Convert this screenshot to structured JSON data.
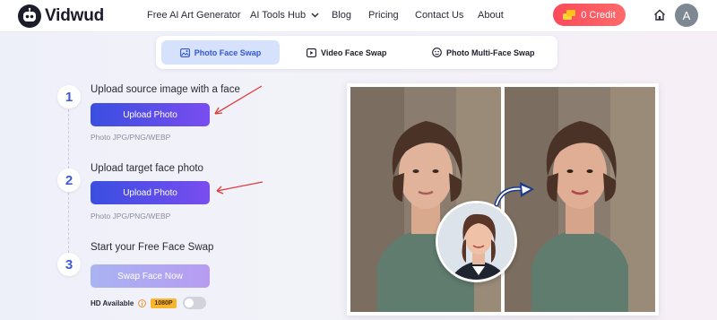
{
  "header": {
    "brand": "Vidwud",
    "nav": [
      {
        "label": "Free AI Art Generator"
      },
      {
        "label": "AI Tools Hub"
      },
      {
        "label": "Blog"
      },
      {
        "label": "Pricing"
      },
      {
        "label": "Contact Us"
      },
      {
        "label": "About"
      }
    ],
    "credit_label": "0 Credit",
    "avatar_letter": "A"
  },
  "tabs": [
    {
      "label": "Photo Face Swap",
      "active": true
    },
    {
      "label": "Video Face Swap",
      "active": false
    },
    {
      "label": "Photo Multi-Face Swap",
      "active": false
    }
  ],
  "steps": [
    {
      "number": "1",
      "title": "Upload source image with a face",
      "button": "Upload Photo",
      "hint": "Photo JPG/PNG/WEBP"
    },
    {
      "number": "2",
      "title": "Upload target face photo",
      "button": "Upload Photo",
      "hint": "Photo JPG/PNG/WEBP"
    },
    {
      "number": "3",
      "title": "Start your Free Face Swap",
      "button": "Swap Face Now"
    }
  ],
  "hd": {
    "label": "HD Available",
    "badge": "1080P",
    "enabled": false
  },
  "colors": {
    "accent": "#3d5ad6",
    "credit": "#fb4a5a",
    "badge": "#f8b62f"
  }
}
